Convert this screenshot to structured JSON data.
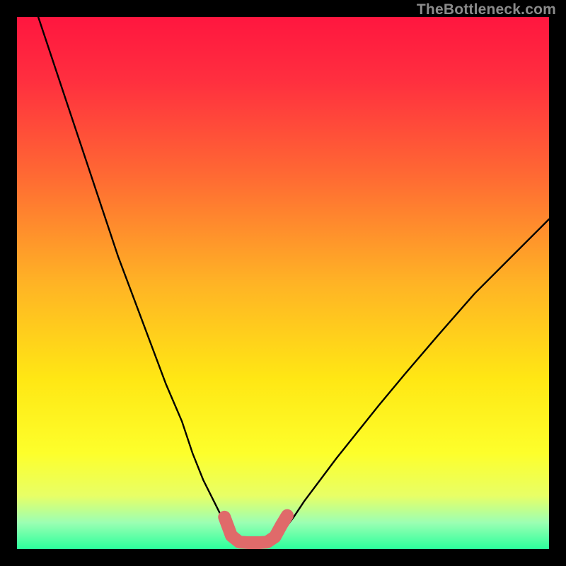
{
  "watermark": "TheBottleneck.com",
  "chart_data": {
    "type": "line",
    "title": "",
    "xlabel": "",
    "ylabel": "",
    "xlim": [
      0,
      100
    ],
    "ylim": [
      0,
      100
    ],
    "gradient_stops": [
      {
        "offset": 0.0,
        "color": "#ff163f"
      },
      {
        "offset": 0.12,
        "color": "#ff2f3f"
      },
      {
        "offset": 0.3,
        "color": "#ff6a33"
      },
      {
        "offset": 0.5,
        "color": "#ffb325"
      },
      {
        "offset": 0.68,
        "color": "#ffe714"
      },
      {
        "offset": 0.82,
        "color": "#fdff2b"
      },
      {
        "offset": 0.9,
        "color": "#e8ff66"
      },
      {
        "offset": 0.95,
        "color": "#9cffb3"
      },
      {
        "offset": 1.0,
        "color": "#2bff9c"
      }
    ],
    "series": [
      {
        "name": "left-curve",
        "stroke": "#000000",
        "x": [
          4,
          7,
          10,
          13,
          16,
          19,
          22,
          25,
          28,
          31,
          33,
          35,
          37,
          38.5,
          39.5,
          40.3
        ],
        "y": [
          100,
          91,
          82,
          73,
          64,
          55,
          47,
          39,
          31,
          24,
          18,
          13,
          9,
          6,
          4,
          2.5
        ]
      },
      {
        "name": "right-curve",
        "stroke": "#000000",
        "x": [
          49.5,
          50.5,
          52,
          54,
          57,
          60,
          64,
          68,
          73,
          79,
          86,
          93,
          100
        ],
        "y": [
          2.5,
          4,
          6,
          9,
          13,
          17,
          22,
          27,
          33,
          40,
          48,
          55,
          62
        ]
      },
      {
        "name": "valley-overlay",
        "stroke": "#e06a6a",
        "x": [
          39.0,
          40.3,
          41.8,
          43.5,
          45.5,
          47.0,
          48.5,
          49.7,
          50.8
        ],
        "y": [
          6,
          2.5,
          1.3,
          1.2,
          1.2,
          1.3,
          2.3,
          4.5,
          6.3
        ]
      }
    ]
  }
}
